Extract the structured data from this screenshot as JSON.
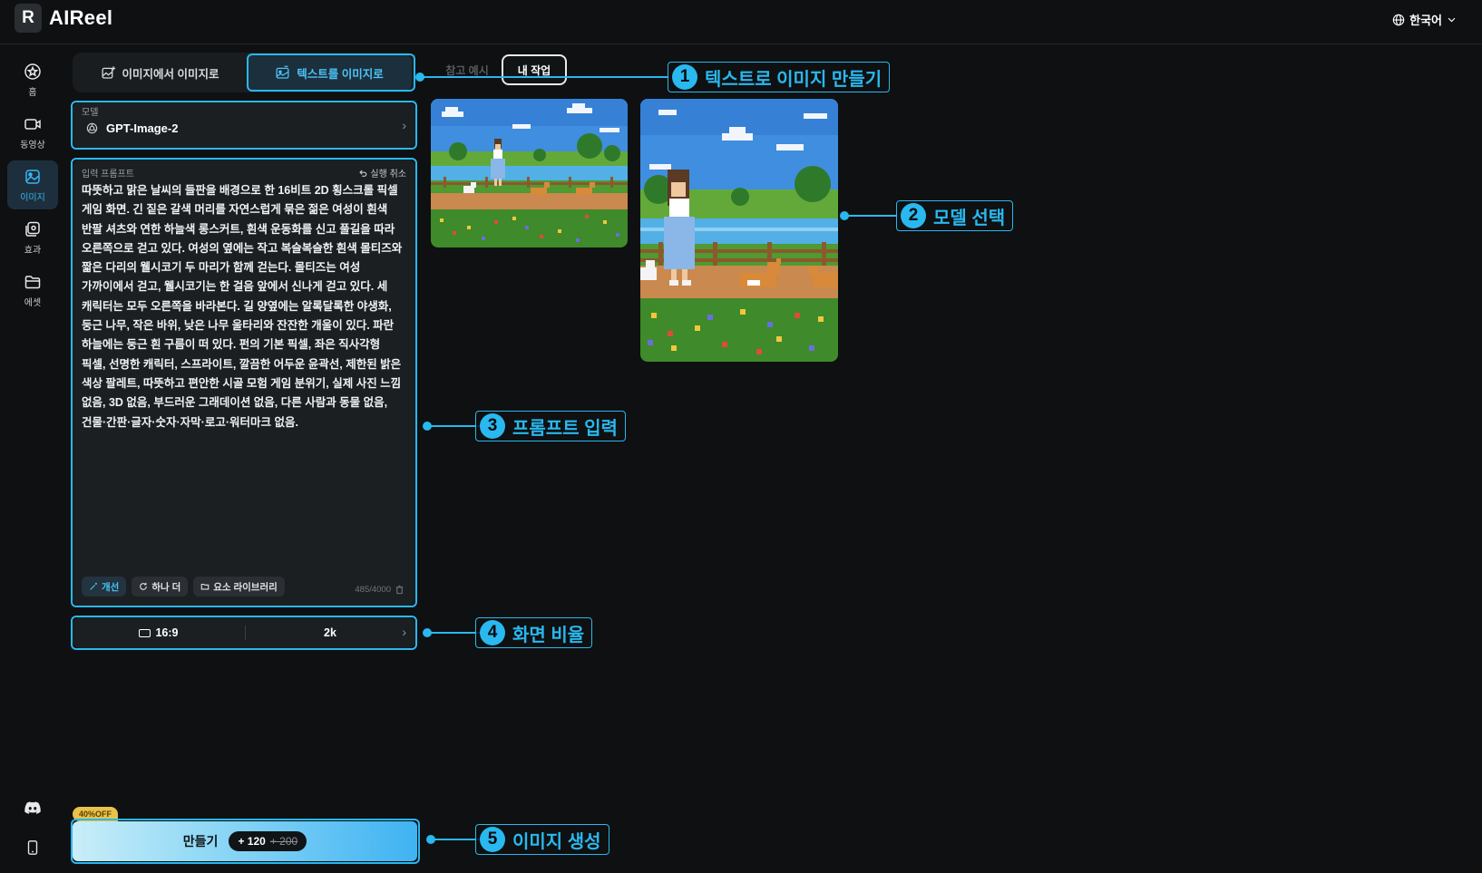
{
  "app": {
    "name": "AIReel",
    "logo_letter": "R"
  },
  "header": {
    "language": "한국어"
  },
  "sidebar": {
    "items": [
      {
        "label": "홈",
        "icon": "star-home-icon"
      },
      {
        "label": "동영상",
        "icon": "video-icon"
      },
      {
        "label": "이미지",
        "icon": "image-icon",
        "active": true
      },
      {
        "label": "효과",
        "icon": "effects-icon"
      },
      {
        "label": "에셋",
        "icon": "folder-icon"
      }
    ],
    "bottom": [
      "discord-icon",
      "mobile-icon"
    ]
  },
  "mode_tabs": {
    "image_to_image": "이미지에서 이미지로",
    "text_to_image": "텍스트를 이미지로",
    "active": "text_to_image"
  },
  "model": {
    "label": "모델",
    "value": "GPT-Image-2"
  },
  "prompt": {
    "label": "입력 프롬프트",
    "undo": "실행 취소",
    "text": "따뜻하고 맑은 날씨의 들판을 배경으로 한 16비트 2D 횡스크롤 픽셀 게임 화면. 긴 짙은 갈색 머리를 자연스럽게 묶은 젊은 여성이 흰색 반팔 셔츠와 연한 하늘색 롱스커트, 흰색 운동화를 신고 풀길을 따라 오른쪽으로 걷고 있다. 여성의 옆에는 작고 복슬복슬한 흰색 몰티즈와 짧은 다리의 웰시코기 두 마리가 함께 걷는다. 몰티즈는 여성 가까이에서 걷고, 웰시코기는 한 걸음 앞에서 신나게 걷고 있다. 세 캐릭터는 모두 오른쪽을 바라본다. 길 양옆에는 알록달록한 야생화, 둥근 나무, 작은 바위, 낮은 나무 울타리와 잔잔한 개울이 있다. 파란 하늘에는 둥근 흰 구름이 떠 있다. 펀의 기본 픽셀, 좌은 직사각형 픽셀, 선명한 캐릭터, 스프라이트, 깔끔한 어두운 윤곽선, 제한된 밝은 색상 팔레트, 따뜻하고 편안한 시골 모험 게임 분위기, 실제 사진 느낌 없음, 3D 없음, 부드러운 그래데이션 없음, 다른 사람과 동물 없음, 건물·간판·글자·숫자·자막·로고·워터마크 없음.",
    "chips": [
      "개선",
      "하나 더",
      "요소 라이브러리"
    ],
    "counter": "485/4000"
  },
  "ratio": {
    "aspect": "16:9",
    "resolution": "2k"
  },
  "create": {
    "badge": "40%OFF",
    "label": "만들기",
    "cost": "+ 120",
    "cost_old": "+ 200"
  },
  "examples": {
    "reference": "참고 예시",
    "mine": "내 작업"
  },
  "callouts": [
    {
      "num": "1",
      "text": "텍스트로 이미지 만들기"
    },
    {
      "num": "2",
      "text": "모델 선택"
    },
    {
      "num": "3",
      "text": "프롬프트 입력"
    },
    {
      "num": "4",
      "text": "화면 비율"
    },
    {
      "num": "5",
      "text": "이미지 생성"
    }
  ],
  "colors": {
    "accent": "#29b8ef",
    "background": "#0e1012",
    "panel": "#1c1f22"
  }
}
